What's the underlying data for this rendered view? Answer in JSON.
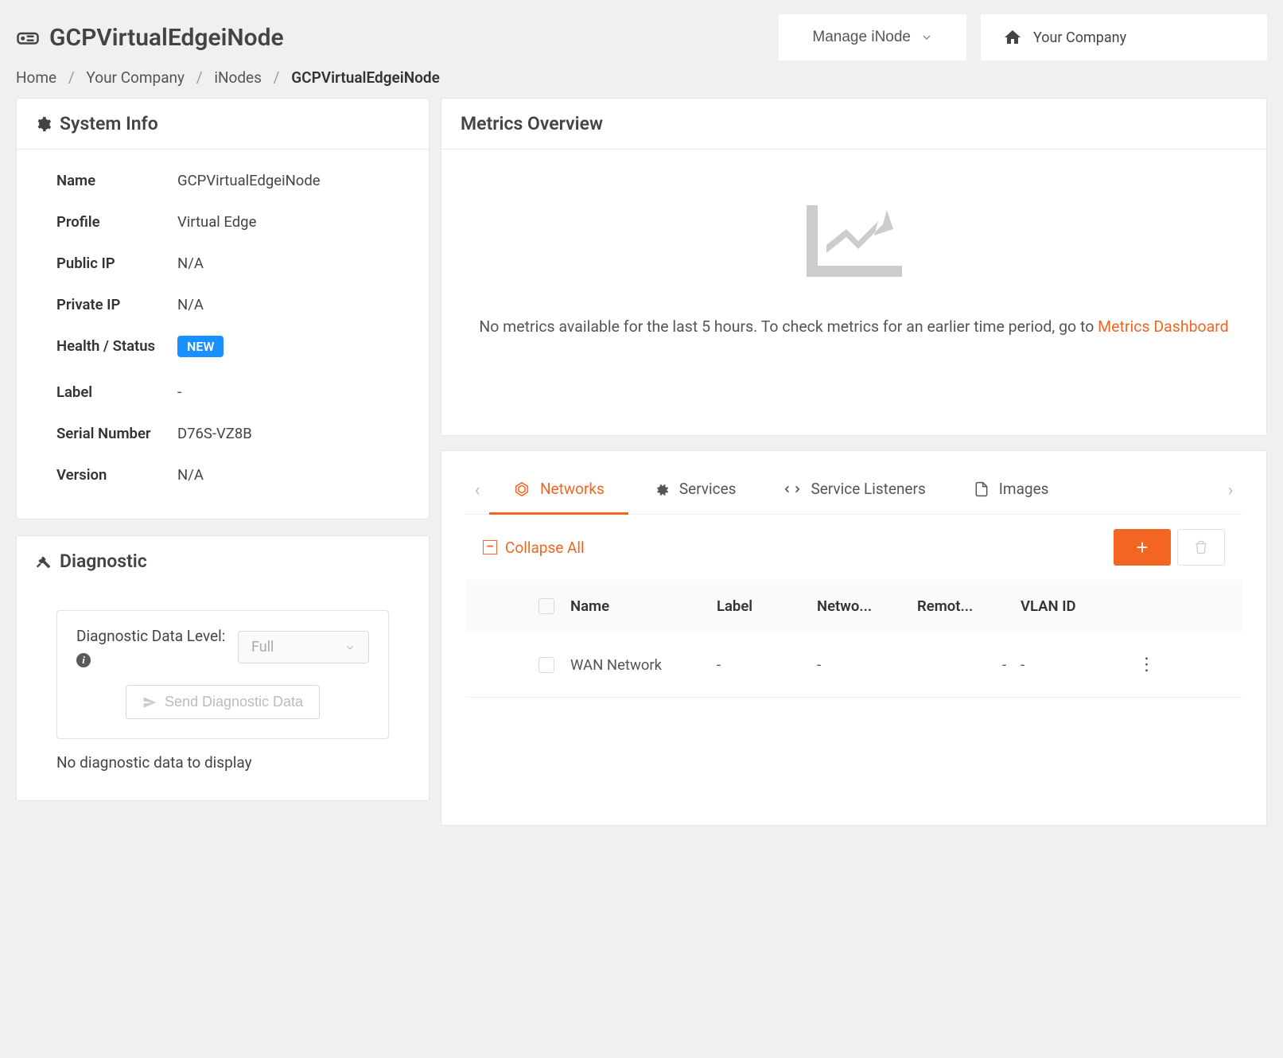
{
  "page": {
    "title": "GCPVirtualEdgeiNode",
    "manage_button": "Manage iNode",
    "company": "Your Company"
  },
  "breadcrumb": {
    "home": "Home",
    "company": "Your Company",
    "inodes": "iNodes",
    "current": "GCPVirtualEdgeiNode"
  },
  "system_info": {
    "title": "System Info",
    "labels": {
      "name": "Name",
      "profile": "Profile",
      "public_ip": "Public IP",
      "private_ip": "Private IP",
      "health": "Health / Status",
      "label": "Label",
      "serial": "Serial Number",
      "version": "Version"
    },
    "values": {
      "name": "GCPVirtualEdgeiNode",
      "profile": "Virtual Edge",
      "public_ip": "N/A",
      "private_ip": "N/A",
      "health_badge": "NEW",
      "label": "-",
      "serial": "D76S-VZ8B",
      "version": "N/A"
    }
  },
  "diagnostic": {
    "title": "Diagnostic",
    "level_label": "Diagnostic Data Level:",
    "level_value": "Full",
    "send_button": "Send Diagnostic Data",
    "empty_text": "No diagnostic data to display"
  },
  "metrics": {
    "title": "Metrics Overview",
    "text_prefix": "No metrics available for the last 5 hours. To check metrics for an earlier time period, go to ",
    "link_text": "Metrics Dashboard"
  },
  "tabs": {
    "networks": "Networks",
    "services": "Services",
    "service_listeners": "Service Listeners",
    "images": "Images"
  },
  "networks_panel": {
    "collapse_all": "Collapse All",
    "columns": {
      "name": "Name",
      "label": "Label",
      "netwo": "Netwo...",
      "remot": "Remot...",
      "vlan": "VLAN ID"
    },
    "rows": [
      {
        "name": "WAN Network",
        "label": "-",
        "netwo": "-",
        "remot": "-",
        "vlan": "-"
      }
    ]
  }
}
